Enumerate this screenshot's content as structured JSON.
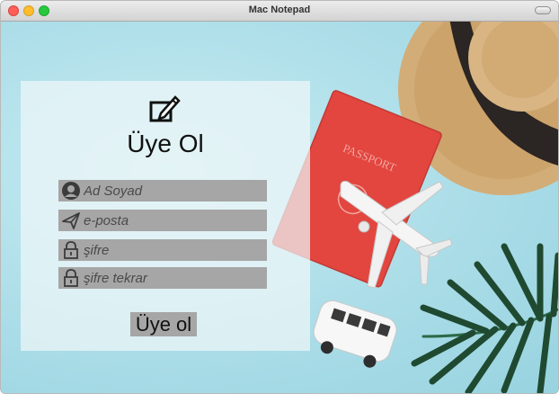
{
  "window": {
    "title": "Mac Notepad"
  },
  "form": {
    "title": "Üye Ol",
    "fields": [
      {
        "placeholder": "Ad Soyad",
        "icon": "user-icon"
      },
      {
        "placeholder": "e-posta",
        "icon": "send-icon"
      },
      {
        "placeholder": "şifre",
        "icon": "lock-icon"
      },
      {
        "placeholder": "şifre tekrar",
        "icon": "lock-icon"
      }
    ],
    "submit_label": "Üye ol",
    "header_icon": "edit-icon"
  },
  "background": {
    "passport_text": "PASSPORT"
  },
  "colors": {
    "panel": "#eef6f8",
    "field": "#a6a6a6",
    "sky": "#a9dce7",
    "passport": "#e34b43"
  }
}
